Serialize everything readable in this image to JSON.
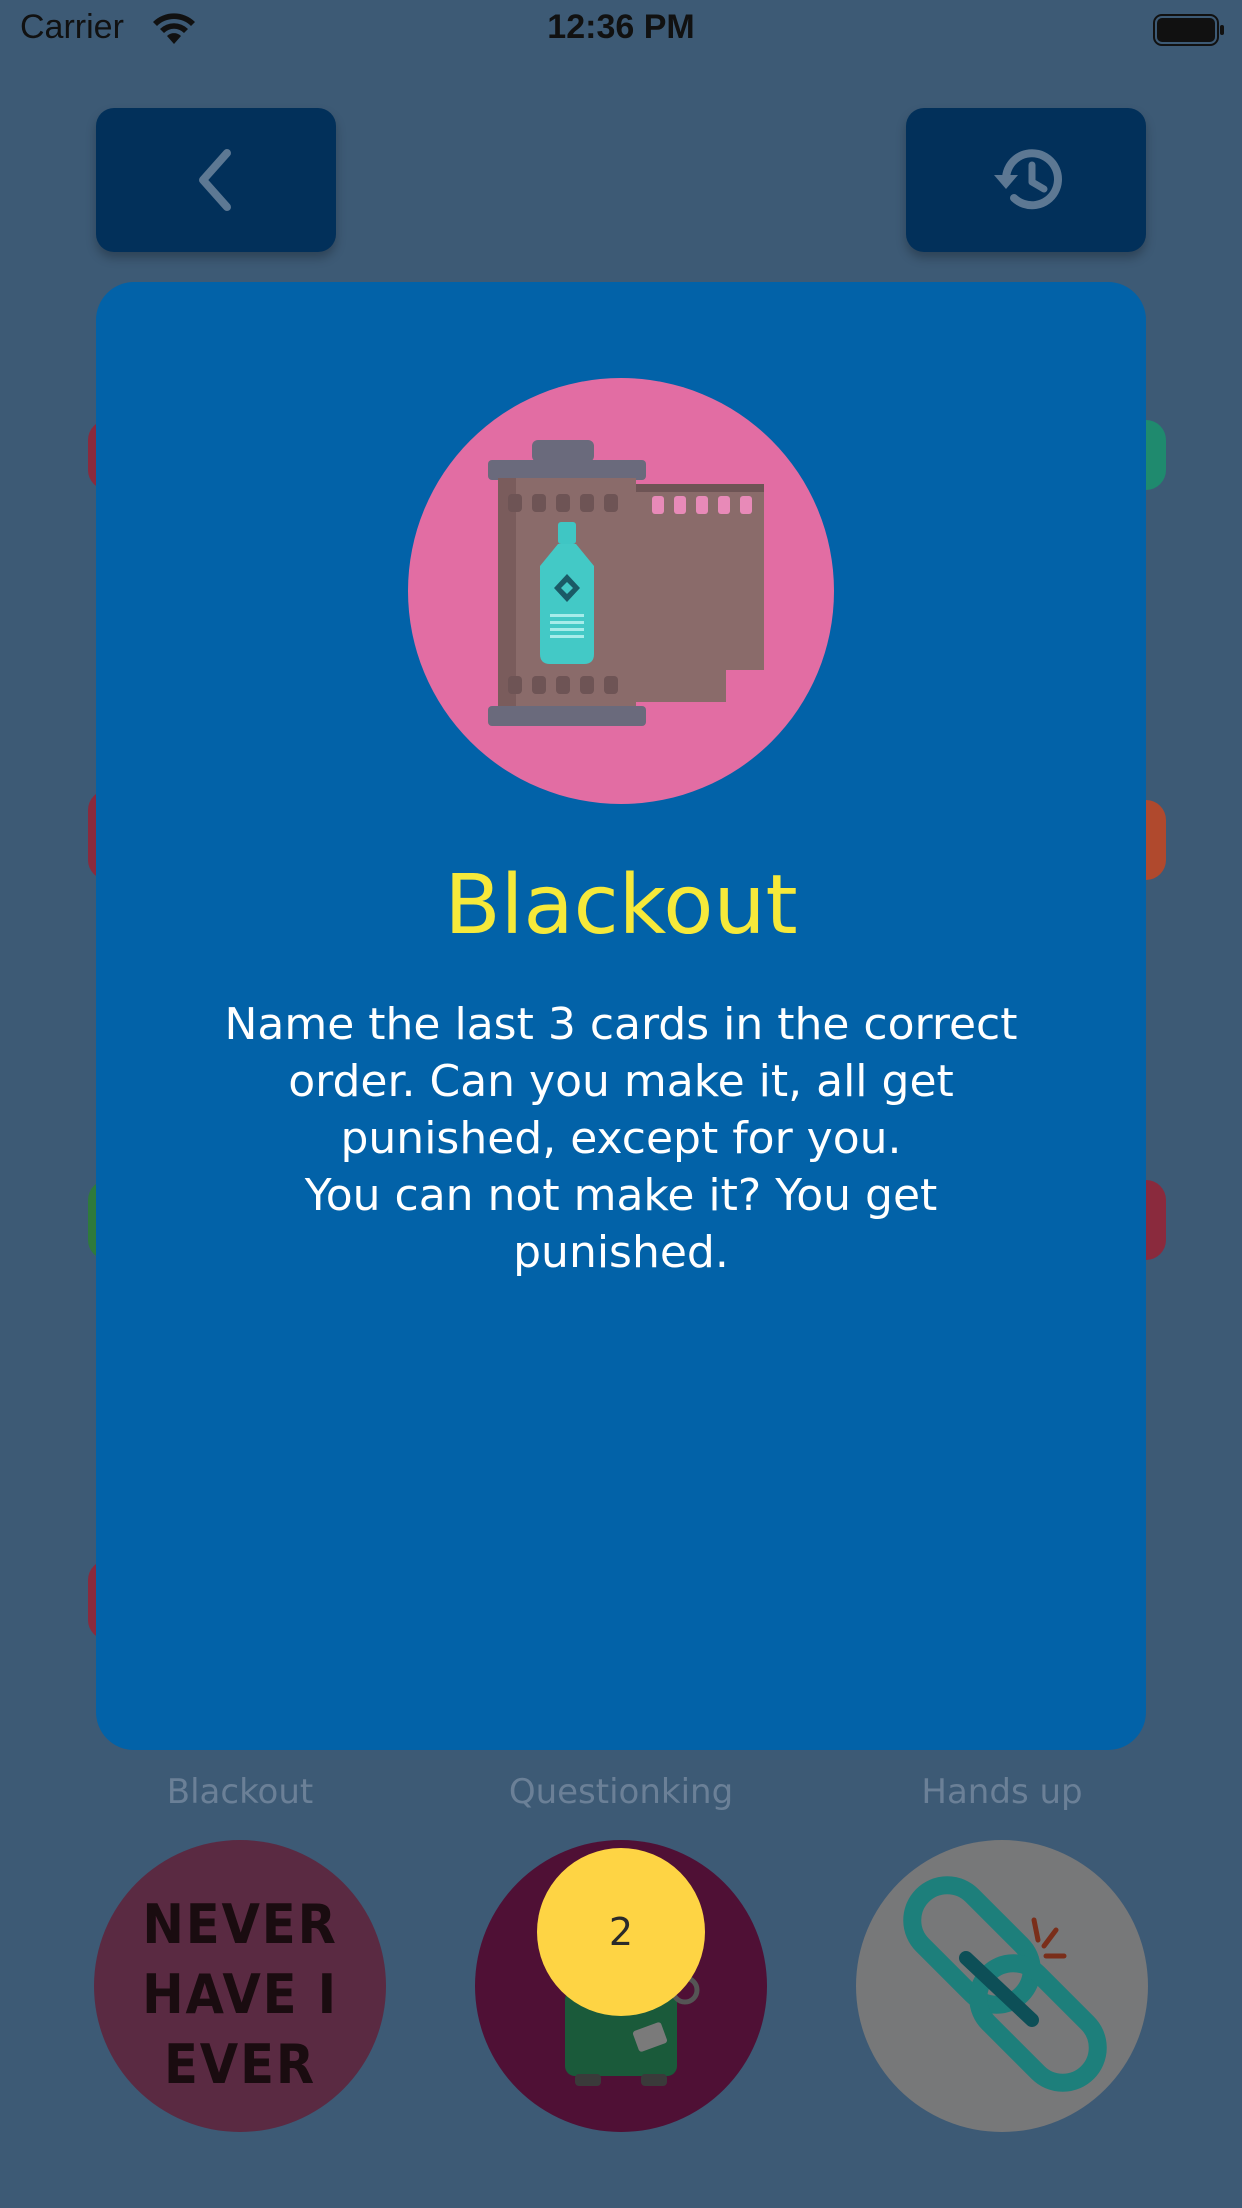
{
  "status_bar": {
    "carrier": "Carrier",
    "time": "12:36 PM"
  },
  "nav": {
    "back_icon": "chevron-left-icon",
    "history_icon": "history-icon"
  },
  "card": {
    "title": "Blackout",
    "description": "Name the last 3 cards in the correct order. Can you make it, all get punished, except for you.\nYou can not make it? You get punished.",
    "image_icon": "film-roll-bottle-icon"
  },
  "games": [
    {
      "label": "Blackout",
      "logo_text": "NEVER\nHAVE I\nEVER"
    },
    {
      "label": "Questionking"
    },
    {
      "label": "Hands up"
    }
  ],
  "badge": {
    "count": "2"
  },
  "colors": {
    "background": "#3d5a75",
    "card": "#0262a8",
    "title": "#f6e93a",
    "badge": "#fed444"
  }
}
